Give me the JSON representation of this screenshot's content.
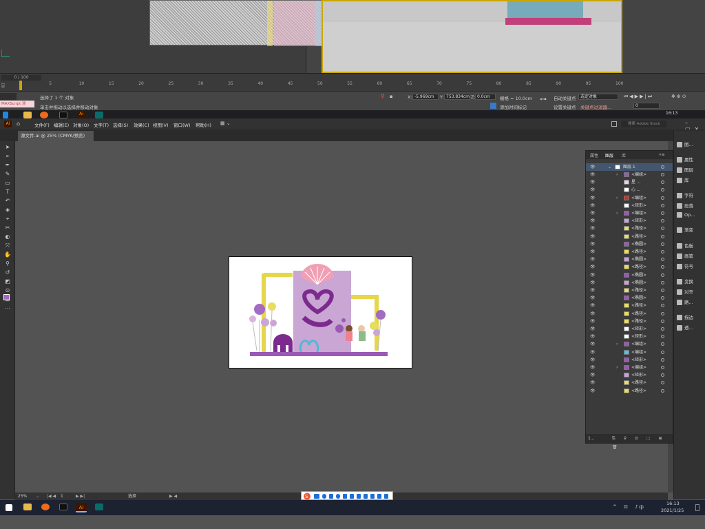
{
  "max": {
    "timeline_counter": "0 / 100",
    "ruler_ticks": [
      "0",
      "5",
      "10",
      "15",
      "20",
      "25",
      "30",
      "35",
      "40",
      "45",
      "50",
      "55",
      "60",
      "65",
      "70",
      "75",
      "80",
      "85",
      "90",
      "95",
      "100"
    ],
    "status_line1": "选择了 1 个 对象",
    "status_line2": "单击并拖动以选择并移动对象",
    "maxscript_label": "MAXScript 迷",
    "coord_x_label": "X:",
    "coord_x": "-5.969cm",
    "coord_y_label": "Y:",
    "coord_y": "753.834cm",
    "coord_z_label": "Z:",
    "coord_z": "0.0cm",
    "grid_label": "栅格 = 10.0cm",
    "add_time_tag": "添加时间标记",
    "auto_key": "自动关键点",
    "selected_object": "选定对象",
    "set_key": "设置关键点",
    "key_filters": "关键点过滤器...",
    "frame_value": "0"
  },
  "taskbar_top": {
    "time": "16:13"
  },
  "ai": {
    "logo": "Ai",
    "menu": [
      "文件(F)",
      "编辑(E)",
      "对象(O)",
      "文字(T)",
      "选择(S)",
      "效果(C)",
      "视图(V)",
      "窗口(W)",
      "帮助(H)"
    ],
    "search_placeholder": "搜索 Adobe Stock",
    "doc_tab": "源文件.ai @ 25% (CMYK/预览)",
    "zoom": "25%",
    "artboard_num": "1",
    "status_tool": "选择",
    "panel_tabs": [
      "属性",
      "图层",
      "库"
    ],
    "layer_top_name": "图层 1",
    "layers": [
      {
        "name": "<编组>",
        "arrow": true,
        "color": "#9b59b6"
      },
      {
        "name": "星 ...",
        "arrow": false,
        "color": "#e8d0ee"
      },
      {
        "name": "心 ...",
        "arrow": false,
        "color": "#ffffff"
      },
      {
        "name": "<编组>",
        "arrow": true,
        "color": "#c0392b"
      },
      {
        "name": "<矩形>",
        "arrow": false,
        "color": "#ffffff"
      },
      {
        "name": "<编组>",
        "arrow": true,
        "color": "#9b59b6"
      },
      {
        "name": "<矩形>",
        "arrow": false,
        "color": "#c8a2d8"
      },
      {
        "name": "<路径>",
        "arrow": false,
        "color": "#e8dd60"
      },
      {
        "name": "<路径>",
        "arrow": false,
        "color": "#e8dd60"
      },
      {
        "name": "<椭圆>",
        "arrow": false,
        "color": "#9b59b6"
      },
      {
        "name": "<路径>",
        "arrow": false,
        "color": "#e8dd60"
      },
      {
        "name": "<椭圆>",
        "arrow": false,
        "color": "#c8a2d8"
      },
      {
        "name": "<路径>",
        "arrow": false,
        "color": "#e8dd60"
      },
      {
        "name": "<椭圆>",
        "arrow": false,
        "color": "#9b59b6"
      },
      {
        "name": "<椭圆>",
        "arrow": false,
        "color": "#c8a2d8"
      },
      {
        "name": "<路径>",
        "arrow": false,
        "color": "#e8dd60"
      },
      {
        "name": "<椭圆>",
        "arrow": false,
        "color": "#9b59b6"
      },
      {
        "name": "<路径>",
        "arrow": false,
        "color": "#e8dd60"
      },
      {
        "name": "<路径>",
        "arrow": false,
        "color": "#e8dd60"
      },
      {
        "name": "<路径>",
        "arrow": false,
        "color": "#e8dd60"
      },
      {
        "name": "<矩形>",
        "arrow": false,
        "color": "#ffffff"
      },
      {
        "name": "<矩形>",
        "arrow": false,
        "color": "#ffffff"
      },
      {
        "name": "<编组>",
        "arrow": true,
        "color": "#9b59b6"
      },
      {
        "name": "<编组>",
        "arrow": false,
        "color": "#4fc3e0"
      },
      {
        "name": "<矩形>",
        "arrow": false,
        "color": "#9b59b6"
      },
      {
        "name": "<编组>",
        "arrow": true,
        "color": "#9b59b6"
      },
      {
        "name": "<矩形>",
        "arrow": false,
        "color": "#c8a2d8"
      },
      {
        "name": "<路径>",
        "arrow": false,
        "color": "#e8dd60"
      },
      {
        "name": "<路径>",
        "arrow": false,
        "color": "#e8dd60"
      }
    ],
    "layers_footer": "1...",
    "dock": [
      {
        "label": "图...",
        "icon": "image-trace-icon"
      },
      {
        "label": "属性",
        "icon": "properties-icon"
      },
      {
        "label": "图层",
        "icon": "layers-icon"
      },
      {
        "label": "库",
        "icon": "libraries-icon"
      },
      {
        "label": "字符",
        "icon": "character-icon"
      },
      {
        "label": "段落",
        "icon": "paragraph-icon"
      },
      {
        "label": "Op...",
        "icon": "opentype-icon"
      },
      {
        "label": "渐变",
        "icon": "gradient-icon"
      },
      {
        "label": "色板",
        "icon": "swatches-icon"
      },
      {
        "label": "画笔",
        "icon": "brushes-icon"
      },
      {
        "label": "符号",
        "icon": "symbols-icon"
      },
      {
        "label": "变换",
        "icon": "transform-icon"
      },
      {
        "label": "对齐",
        "icon": "align-icon"
      },
      {
        "label": "路...",
        "icon": "pathfinder-icon"
      },
      {
        "label": "描边",
        "icon": "stroke-icon"
      },
      {
        "label": "透...",
        "icon": "transparency-icon"
      }
    ]
  },
  "taskbar_bottom": {
    "time": "16:13",
    "date": "2021/1/25",
    "ime": "中"
  }
}
